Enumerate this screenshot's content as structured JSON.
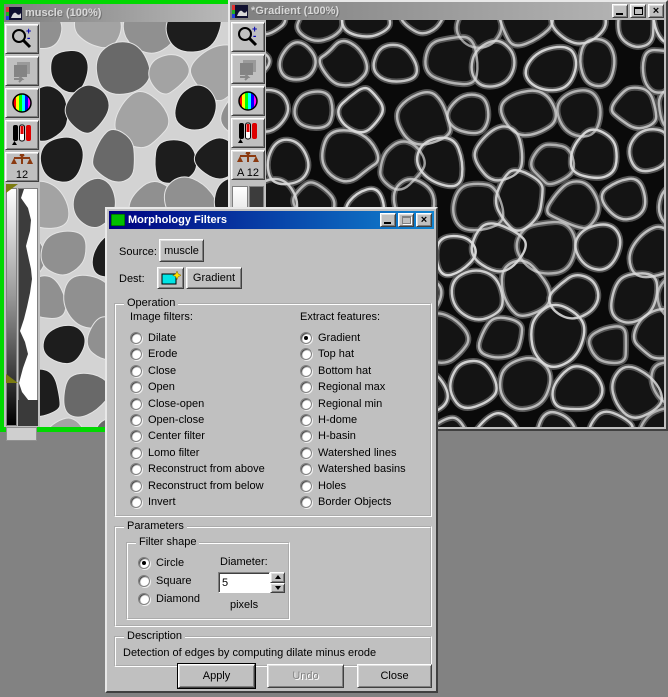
{
  "desktop": {
    "background": "#828282",
    "selection_border_color": "#00d800"
  },
  "windows": {
    "muscle": {
      "title": "muscle (100%)",
      "calibration_label": "12",
      "toolbar_icons": [
        "zoom-tool",
        "duplicate-image",
        "palette",
        "levels",
        "calibration"
      ]
    },
    "gradient": {
      "title": "*Gradient (100%)",
      "calibration_label": "A 12",
      "toolbar_icons": [
        "zoom-tool",
        "duplicate-image",
        "palette",
        "levels",
        "calibration"
      ],
      "window_buttons": [
        "minimize",
        "maximize",
        "close"
      ]
    }
  },
  "dialog": {
    "title": "Morphology Filters",
    "window_buttons": [
      "minimize",
      "maximize-disabled",
      "close"
    ],
    "source": {
      "label": "Source:",
      "button": "muscle"
    },
    "dest": {
      "label": "Dest:",
      "new_image_button": "new-image-icon",
      "button": "Gradient"
    },
    "operation": {
      "legend": "Operation",
      "image_filters": {
        "label": "Image filters:",
        "options": [
          "Dilate",
          "Erode",
          "Close",
          "Open",
          "Close-open",
          "Open-close",
          "Center filter",
          "Lomo filter",
          "Reconstruct from above",
          "Reconstruct from below",
          "Invert"
        ],
        "selected": null
      },
      "extract_features": {
        "label": "Extract features:",
        "options": [
          "Gradient",
          "Top hat",
          "Bottom hat",
          "Regional max",
          "Regional min",
          "H-dome",
          "H-basin",
          "Watershed lines",
          "Watershed basins",
          "Holes",
          "Border Objects"
        ],
        "selected": "Gradient"
      }
    },
    "parameters": {
      "legend": "Parameters",
      "filter_shape": {
        "legend": "Filter shape",
        "options": [
          "Circle",
          "Square",
          "Diamond"
        ],
        "selected": "Circle"
      },
      "diameter": {
        "label": "Diameter:",
        "value": "5",
        "unit": "pixels"
      }
    },
    "description": {
      "legend": "Description",
      "text": "Detection of edges by computing dilate minus erode"
    },
    "buttons": {
      "apply": {
        "label": "Apply",
        "default": true
      },
      "undo": {
        "label": "Undo",
        "disabled": true
      },
      "close": {
        "label": "Close"
      }
    }
  }
}
